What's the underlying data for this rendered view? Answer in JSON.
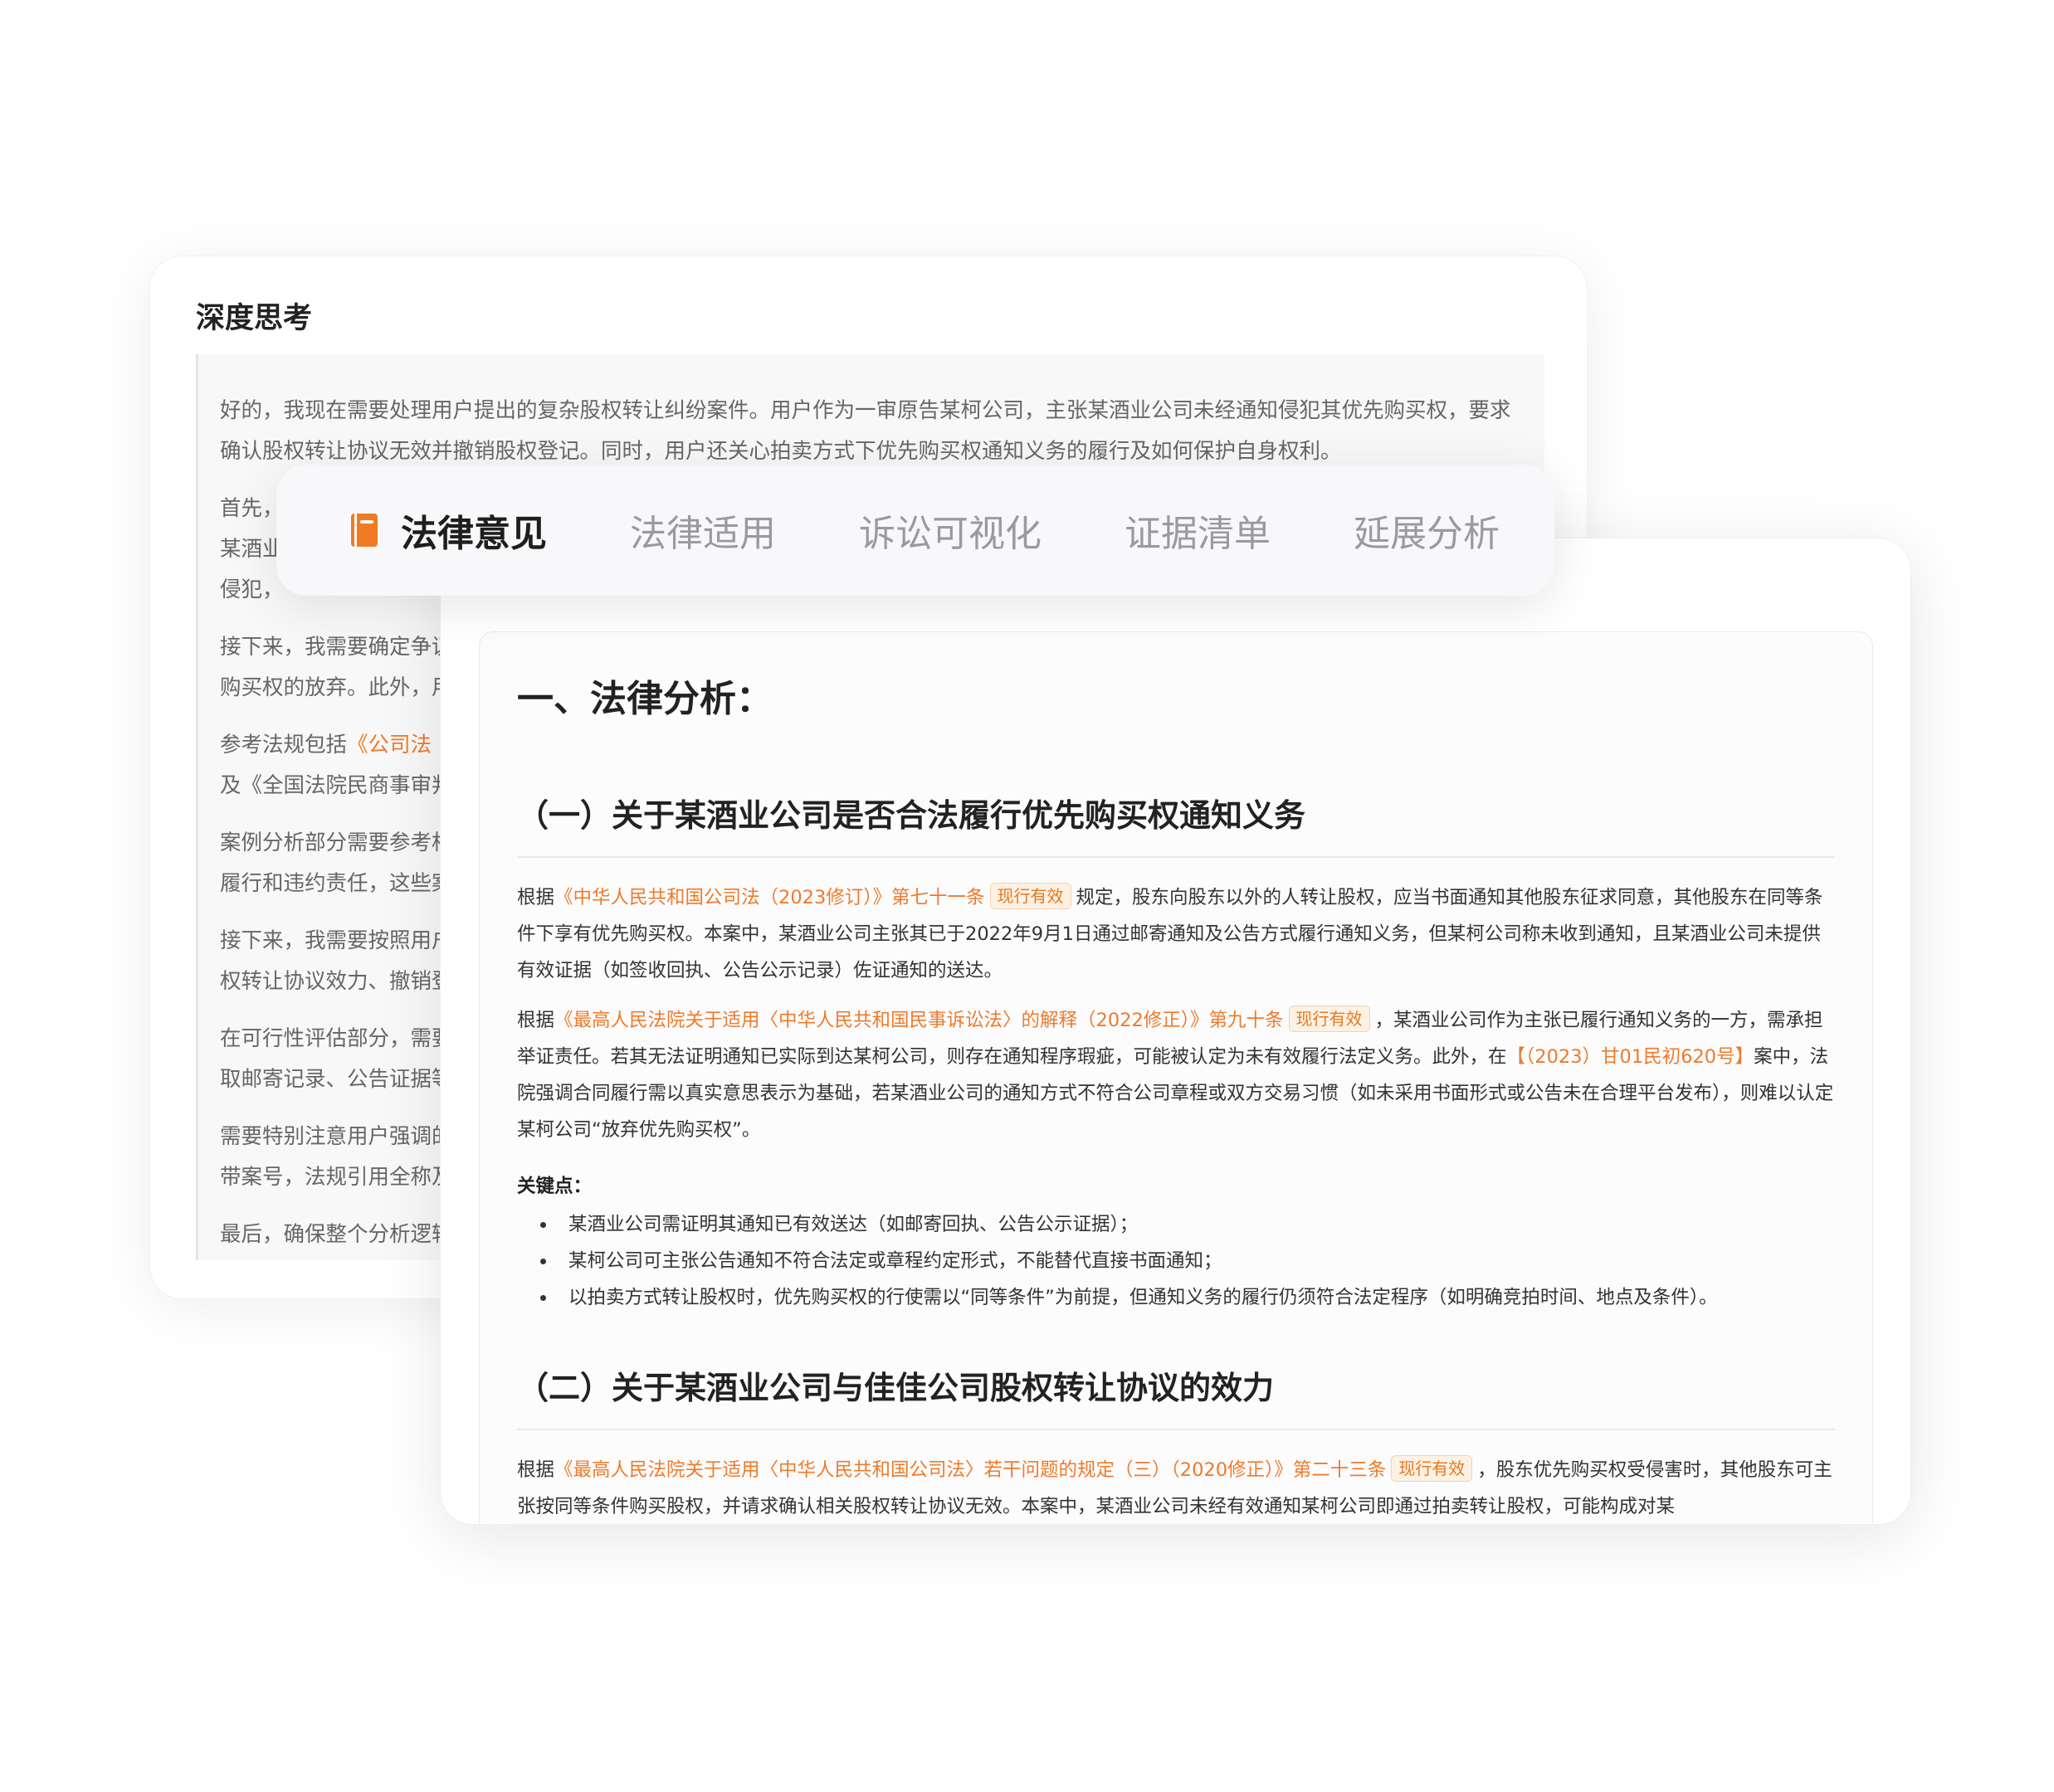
{
  "thinking": {
    "title": "深度思考",
    "paragraphs": [
      {
        "text": "好的，我现在需要处理用户提出的复杂股权转让纠纷案件。用户作为一审原告某柯公司，主张某酒业公司未经通知侵犯其优先购买权，要求确认股权转让协议无效并撤销股权登记。同时，用户还关心拍卖方式下优先购买权通知义务的履行及如何保护自身权利。"
      },
      {
        "text": "首先，"
      },
      {
        "text": "某酒业"
      },
      {
        "text": "侵犯，"
      },
      {
        "text": "接下来，我需要确定争议"
      },
      {
        "text": "购买权的放弃。此外，用"
      },
      {
        "prefix": "参考法规包括",
        "ref": "《公司法"
      },
      {
        "text": "及《全国法院民商事审判"
      },
      {
        "text": "案例分析部分需要参考相"
      },
      {
        "text": "履行和违约责任，这些案"
      },
      {
        "text": "接下来，我需要按照用户"
      },
      {
        "text": "权转让协议效力、撤销登"
      },
      {
        "text": "在可行性评估部分，需要"
      },
      {
        "text": "取邮寄记录、公告证据等"
      },
      {
        "text": "需要特别注意用户强调的"
      },
      {
        "text": "带案号，法规引用全称及"
      },
      {
        "text": "最后，确保整个分析逻辑"
      }
    ]
  },
  "tabs": [
    {
      "label": "法律意见",
      "active": true
    },
    {
      "label": "法律适用",
      "active": false
    },
    {
      "label": "诉讼可视化",
      "active": false
    },
    {
      "label": "证据清单",
      "active": false
    },
    {
      "label": "延展分析",
      "active": false
    }
  ],
  "opinion": {
    "heading": "一、法律分析：",
    "section1": {
      "title": "（一）关于某酒业公司是否合法履行优先购买权通知义务",
      "p1": {
        "prefix": "根据",
        "ref": "《中华人民共和国公司法（2023修订）》第七十一条",
        "badge": "现行有效",
        "text": "规定，股东向股东以外的人转让股权，应当书面通知其他股东征求同意，其他股东在同等条件下享有优先购买权。本案中，某酒业公司主张其已于2022年9月1日通过邮寄通知及公告方式履行通知义务，但某柯公司称未收到通知，且某酒业公司未提供有效证据（如签收回执、公告公示记录）佐证通知的送达。"
      },
      "p2": {
        "prefix": "根据",
        "ref": "《最高人民法院关于适用〈中华人民共和国民事诉讼法〉的解释（2022修正）》第九十条",
        "badge": "现行有效",
        "text1": "，某酒业公司作为主张已履行通知义务的一方，需承担举证责任。若其无法证明通知已实际到达某柯公司，则存在通知程序瑕疵，可能被认定为未有效履行法定义务。此外，在",
        "case_ref": "【（2023）甘01民初620号】",
        "text2": "案中，法院强调合同履行需以真实意思表示为基础，若某酒业公司的通知方式不符合公司章程或双方交易习惯（如未采用书面形式或公告未在合理平台发布），则难以认定某柯公司“放弃优先购买权”。"
      },
      "keypoints_title": "关键点：",
      "keypoints": [
        "某酒业公司需证明其通知已有效送达（如邮寄回执、公告公示证据）；",
        "某柯公司可主张公告通知不符合法定或章程约定形式，不能替代直接书面通知；",
        "以拍卖方式转让股权时，优先购买权的行使需以“同等条件”为前提，但通知义务的履行仍须符合法定程序（如明确竞拍时间、地点及条件）。"
      ]
    },
    "section2": {
      "title": "（二）关于某酒业公司与佳佳公司股权转让协议的效力",
      "p1": {
        "prefix": "根据",
        "ref": "《最高人民法院关于适用〈中华人民共和国公司法〉若干问题的规定（三）（2020修正）》第二十三条",
        "badge": "现行有效",
        "text": "，股东优先购买权受侵害时，其他股东可主张按同等条件购买股权，并请求确认相关股权转让协议无效。本案中，某酒业公司未经有效通知某柯公司即通过拍卖转让股权，可能构成对某"
      }
    }
  },
  "colors": {
    "accent": "#ef7a2b",
    "badge_bg": "#fdf1e4",
    "tab_inactive": "#9a9a9e"
  }
}
